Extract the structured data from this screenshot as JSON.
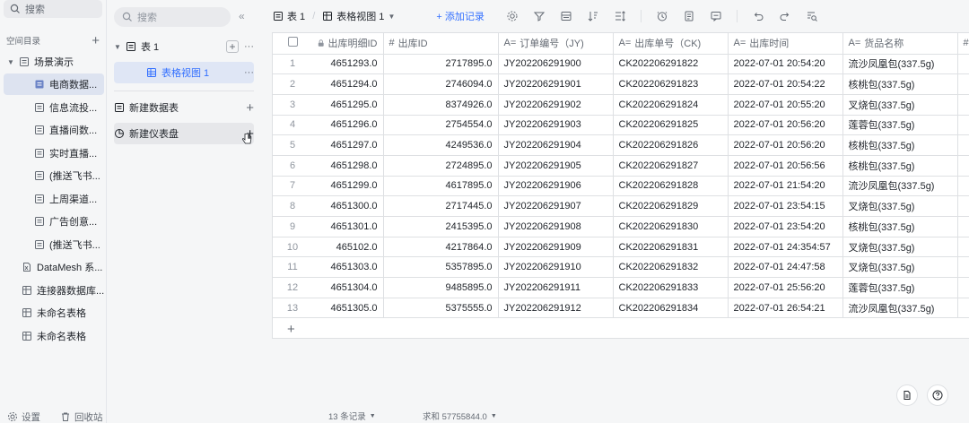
{
  "workspace": {
    "search_placeholder": "搜索",
    "section_title": "空间目录",
    "tree": [
      {
        "label": "场景演示",
        "type": "folder",
        "expanded": true
      },
      {
        "label": "电商数据...",
        "type": "table",
        "selected": true
      },
      {
        "label": "信息流投...",
        "type": "table"
      },
      {
        "label": "直播间数...",
        "type": "table"
      },
      {
        "label": "实时直播...",
        "type": "table"
      },
      {
        "label": "(推送飞书...",
        "type": "table"
      },
      {
        "label": "上周渠道...",
        "type": "table"
      },
      {
        "label": "广告创意...",
        "type": "table"
      },
      {
        "label": "(推送飞书...",
        "type": "table"
      },
      {
        "label": "DataMesh 系...",
        "type": "excel"
      },
      {
        "label": "连接器数据库...",
        "type": "grid"
      },
      {
        "label": "未命名表格",
        "type": "grid"
      },
      {
        "label": "未命名表格",
        "type": "grid"
      }
    ],
    "footer": {
      "settings": "设置",
      "trash": "回收站"
    }
  },
  "panel": {
    "search_placeholder": "搜索",
    "table_name": "表 1",
    "view_name": "表格视图 1",
    "new_table": "新建数据表",
    "new_dashboard": "新建仪表盘"
  },
  "toolbar": {
    "table": "表 1",
    "view": "表格视图 1",
    "add_record": "+ 添加记录"
  },
  "grid": {
    "columns": [
      {
        "label": "出库明细ID",
        "icon": "lock"
      },
      {
        "label": "出库ID",
        "icon": "#"
      },
      {
        "label": "订单编号（JY)",
        "icon": "A="
      },
      {
        "label": "出库单号（CK)",
        "icon": "A="
      },
      {
        "label": "出库时间",
        "icon": "A="
      },
      {
        "label": "货品名称",
        "icon": "A="
      },
      {
        "label": "",
        "icon": "#"
      }
    ],
    "rows": [
      [
        "1",
        "4651293.0",
        "2717895.0",
        "JY202206291900",
        "CK202206291822",
        "2022-07-01 20:54:20",
        "流沙凤凰包(337.5g)"
      ],
      [
        "2",
        "4651294.0",
        "2746094.0",
        "JY202206291901",
        "CK202206291823",
        "2022-07-01 20:54:22",
        "核桃包(337.5g)"
      ],
      [
        "3",
        "4651295.0",
        "8374926.0",
        "JY202206291902",
        "CK202206291824",
        "2022-07-01 20:55:20",
        "叉烧包(337.5g)"
      ],
      [
        "4",
        "4651296.0",
        "2754554.0",
        "JY202206291903",
        "CK202206291825",
        "2022-07-01 20:56:20",
        "莲蓉包(337.5g)"
      ],
      [
        "5",
        "4651297.0",
        "4249536.0",
        "JY202206291904",
        "CK202206291826",
        "2022-07-01 20:56:20",
        "核桃包(337.5g)"
      ],
      [
        "6",
        "4651298.0",
        "2724895.0",
        "JY202206291905",
        "CK202206291827",
        "2022-07-01 20:56:56",
        "核桃包(337.5g)"
      ],
      [
        "7",
        "4651299.0",
        "4617895.0",
        "JY202206291906",
        "CK202206291828",
        "2022-07-01 21:54:20",
        "流沙凤凰包(337.5g)"
      ],
      [
        "8",
        "4651300.0",
        "2717445.0",
        "JY202206291907",
        "CK202206291829",
        "2022-07-01 23:54:15",
        "叉烧包(337.5g)"
      ],
      [
        "9",
        "4651301.0",
        "2415395.0",
        "JY202206291908",
        "CK202206291830",
        "2022-07-01 23:54:20",
        "核桃包(337.5g)"
      ],
      [
        "10",
        "465102.0",
        "4217864.0",
        "JY202206291909",
        "CK202206291831",
        "2022-07-01 24:354:57",
        "叉烧包(337.5g)"
      ],
      [
        "11",
        "4651303.0",
        "5357895.0",
        "JY202206291910",
        "CK202206291832",
        "2022-07-01 24:47:58",
        "叉烧包(337.5g)"
      ],
      [
        "12",
        "4651304.0",
        "9485895.0",
        "JY202206291911",
        "CK202206291833",
        "2022-07-01 25:56:20",
        "莲蓉包(337.5g)"
      ],
      [
        "13",
        "4651305.0",
        "5375555.0",
        "JY202206291912",
        "CK202206291834",
        "2022-07-01 26:54:21",
        "流沙凤凰包(337.5g)"
      ]
    ]
  },
  "status": {
    "records": "13 条记录",
    "sum": "求和 57755844.0"
  },
  "colors": {
    "accent": "#3370ff",
    "sidebar_bg": "#f5f6f7",
    "selected_bg": "#dde3f0"
  }
}
